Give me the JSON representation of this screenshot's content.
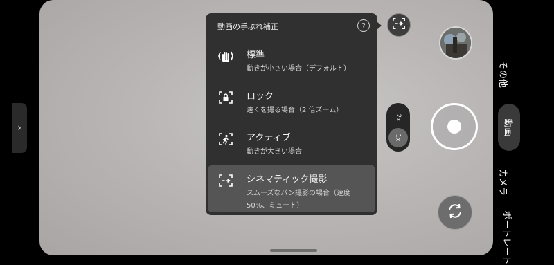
{
  "panel": {
    "title": "動画の手ぶれ補正",
    "help_icon": "?",
    "options": [
      {
        "title": "標準",
        "desc": "動きが小さい場合（デフォルト）",
        "icon": "hand-stabilization-icon"
      },
      {
        "title": "ロック",
        "desc": "遠くを撮る場合（2 倍ズーム）",
        "icon": "lock-frame-icon"
      },
      {
        "title": "アクティブ",
        "desc": "動きが大きい場合",
        "icon": "running-frame-icon"
      },
      {
        "title": "シネマティック撮影",
        "desc": "スムーズなパン撮影の場合（速度 50%、ミュート）",
        "icon": "pan-frame-icon",
        "selected": true
      }
    ]
  },
  "zoom": {
    "option_2x": "2x",
    "option_1x": "1x",
    "selected": "1x"
  },
  "side_tab": {
    "glyph": "›"
  },
  "modes": {
    "other": "その他",
    "video": "動画",
    "camera": "カメラ",
    "portrait": "ポートレート",
    "active": "動画"
  },
  "colors": {
    "panel_bg": "#303030",
    "selected_row": "#555555",
    "background": "#000000"
  }
}
